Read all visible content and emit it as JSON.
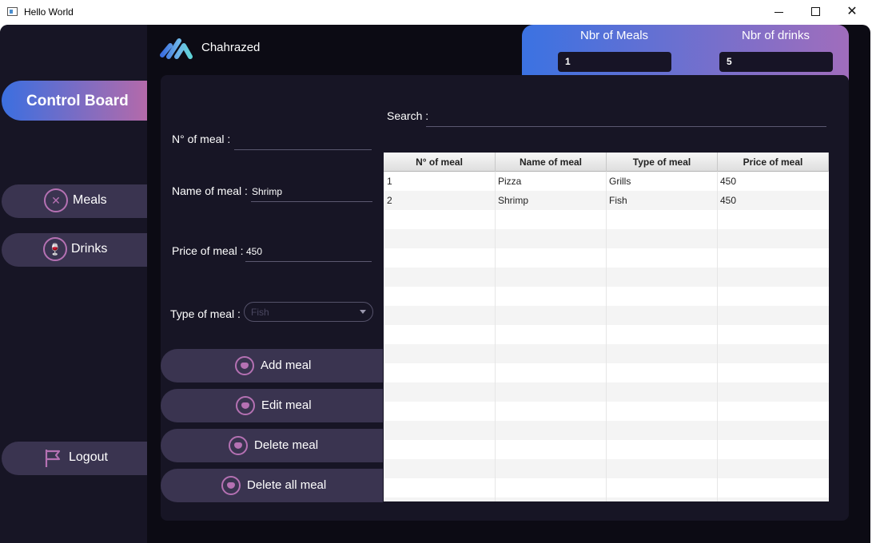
{
  "window": {
    "title": "Hello World",
    "controls": {
      "minimize": "—",
      "maximize": "☐",
      "close": "✕"
    }
  },
  "sidebar": {
    "control_board": "Control Board",
    "meals": "Meals",
    "drinks": "Drinks",
    "logout": "Logout"
  },
  "header": {
    "username": "Chahrazed"
  },
  "stats": {
    "meals_label": "Nbr of Meals",
    "meals_value": "1",
    "drinks_label": "Nbr of drinks",
    "drinks_value": "5"
  },
  "form": {
    "meal_no_label": "N° of meal :",
    "meal_no_value": "",
    "name_label": "Name of meal :",
    "name_value": "Shrimp",
    "price_label": "Price of meal :",
    "price_value": "450",
    "type_label": "Type of meal :",
    "type_value": "Fish"
  },
  "search": {
    "label": "Search :",
    "value": ""
  },
  "actions": {
    "add": "Add meal",
    "edit": "Edit meal",
    "delete": "Delete meal",
    "delete_all": "Delete all meal"
  },
  "table": {
    "headers": [
      "N° of meal",
      "Name of meal",
      "Type of meal",
      "Price of meal"
    ],
    "rows": [
      [
        "1",
        "Pizza",
        "Grills",
        "450"
      ],
      [
        "2",
        "Shrimp",
        "Fish",
        "450"
      ]
    ]
  },
  "colors": {
    "accent_start": "#3b6fe0",
    "accent_end": "#b46aaa",
    "background": "#0c0b14",
    "panel": "#171525",
    "button": "#3a3450",
    "icon": "#b571b3"
  }
}
